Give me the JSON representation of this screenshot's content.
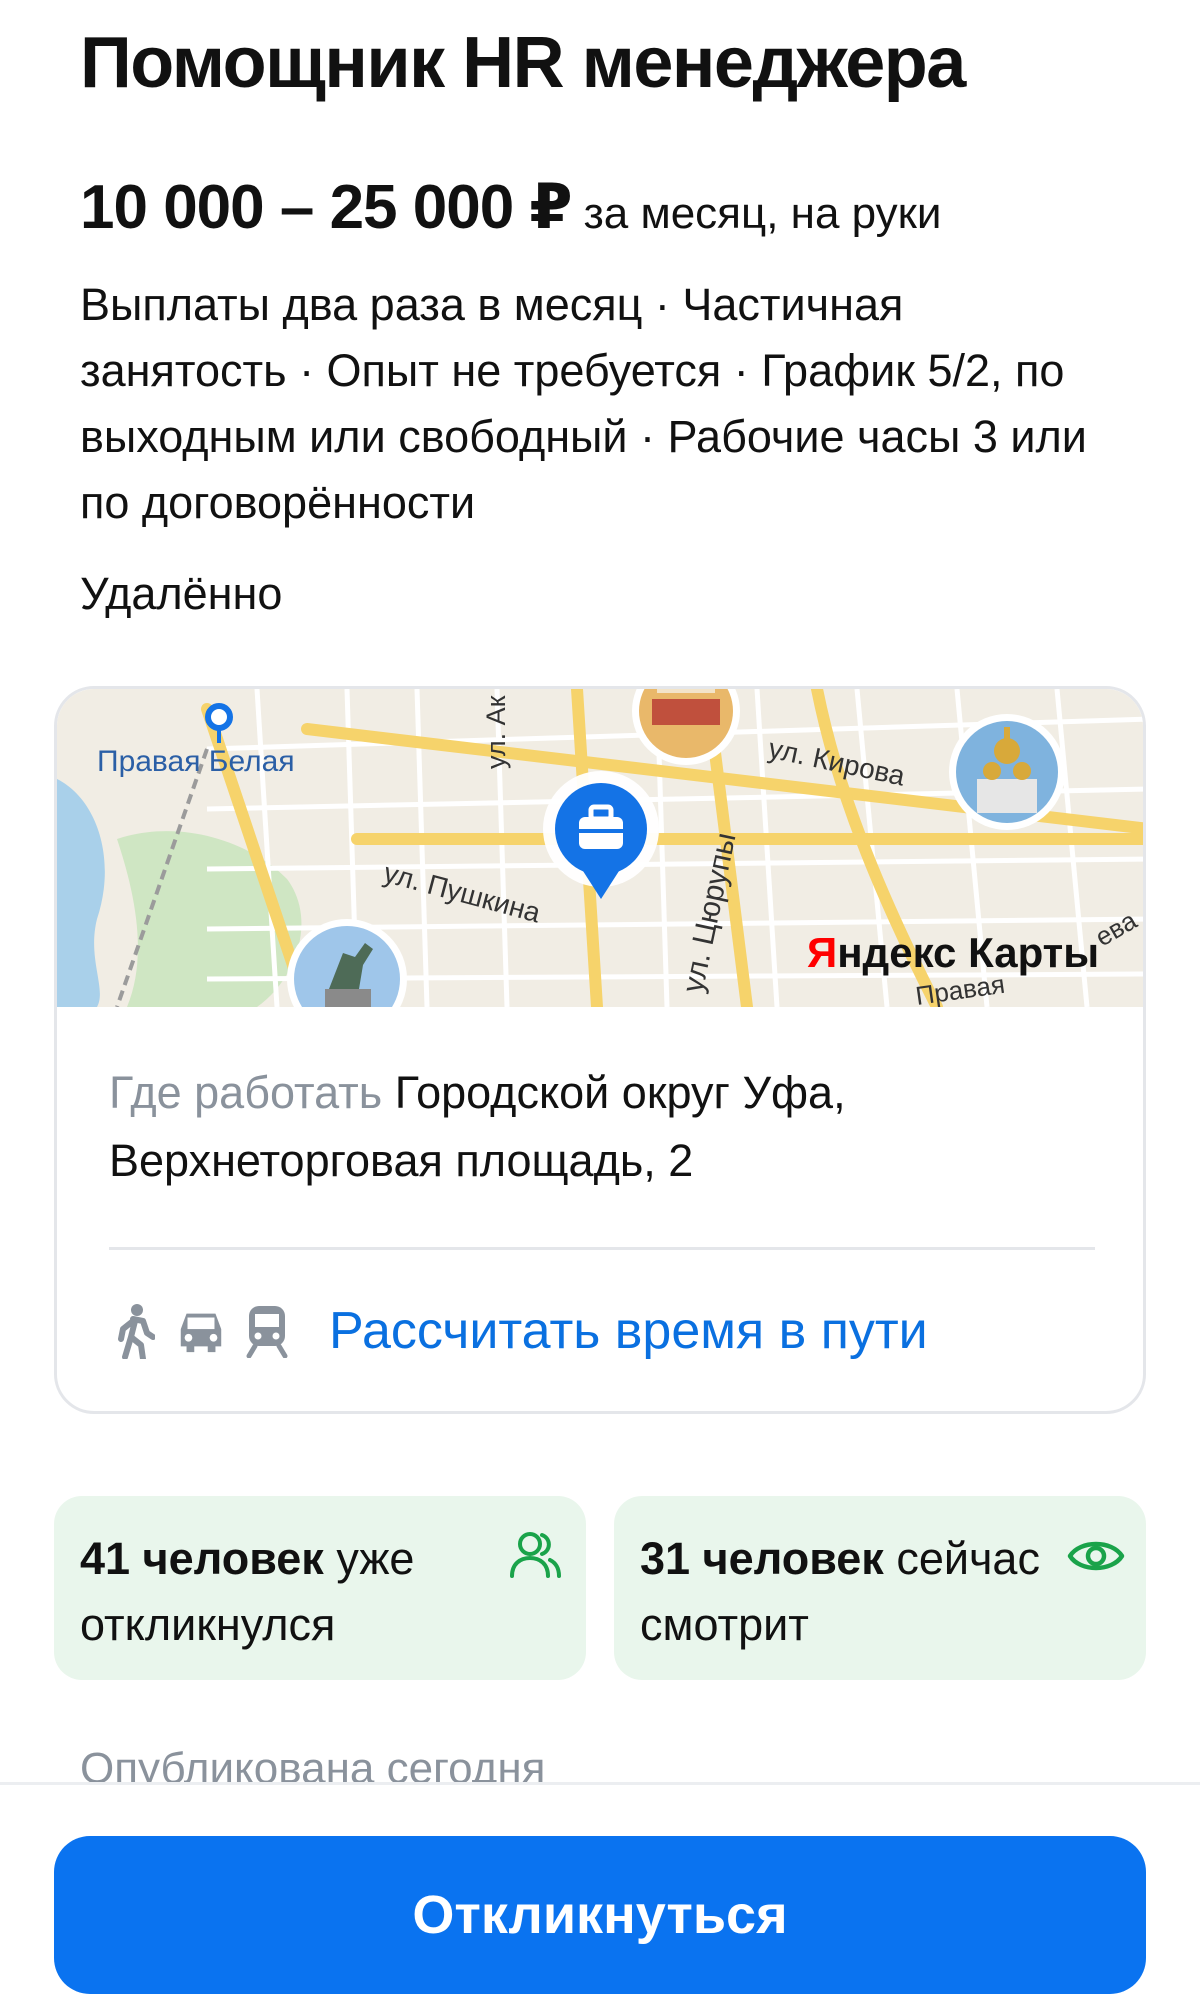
{
  "vacancy": {
    "title": "Помощник HR менеджера",
    "salary_amount": "10 000 – 25 000 ₽",
    "salary_period": "за месяц, на руки",
    "conditions": "Выплаты два раза в месяц · Частичная занятость · Опыт не требуется · График 5/2, по выходным или свободный · Рабочие часы 3 или по договорённости",
    "work_format": "Удалённо"
  },
  "map": {
    "labels": {
      "district": "Правая Белая",
      "street_a": "ул. Ак",
      "street_kirova": "ул. Кирова",
      "street_pushkina": "ул. Пушкина",
      "street_tsyurupy": "ул. Цюрупы",
      "street_bottom": "Правая",
      "street_edge": "ева"
    },
    "brand_first": "Я",
    "brand_rest": "ндекс Карты",
    "colors": {
      "background": "#f1ede4",
      "major_road": "#f6d36b",
      "minor_road": "#ffffff",
      "park": "#cfe6c3",
      "water": "#a9d0ea",
      "pin": "#1473e6",
      "brand_red": "#ff0000"
    },
    "icons": [
      "briefcase-pin-icon",
      "cathedral-photo-icon",
      "monument-photo-icon",
      "building-photo-icon"
    ]
  },
  "location": {
    "label": "Где работать",
    "address": "Городской округ Уфа, Верхнеторговая площадь, 2",
    "route_icons": [
      "walk-icon",
      "car-icon",
      "train-icon"
    ],
    "route_link": "Рассчитать время в пути"
  },
  "stats": {
    "responded_bold": "41 человек",
    "responded_rest": " уже откликнулся",
    "watching_bold": "31 человек",
    "watching_rest": " сейчас смотрит",
    "icons": [
      "people-icon",
      "eye-icon"
    ],
    "background": "#e9f6ec",
    "icon_color": "#1aa34a"
  },
  "published": "Опубликована сегодня",
  "footer": {
    "respond_button": "Откликнуться",
    "button_color": "#0a73f0"
  },
  "accent_link_color": "#0a70e0"
}
